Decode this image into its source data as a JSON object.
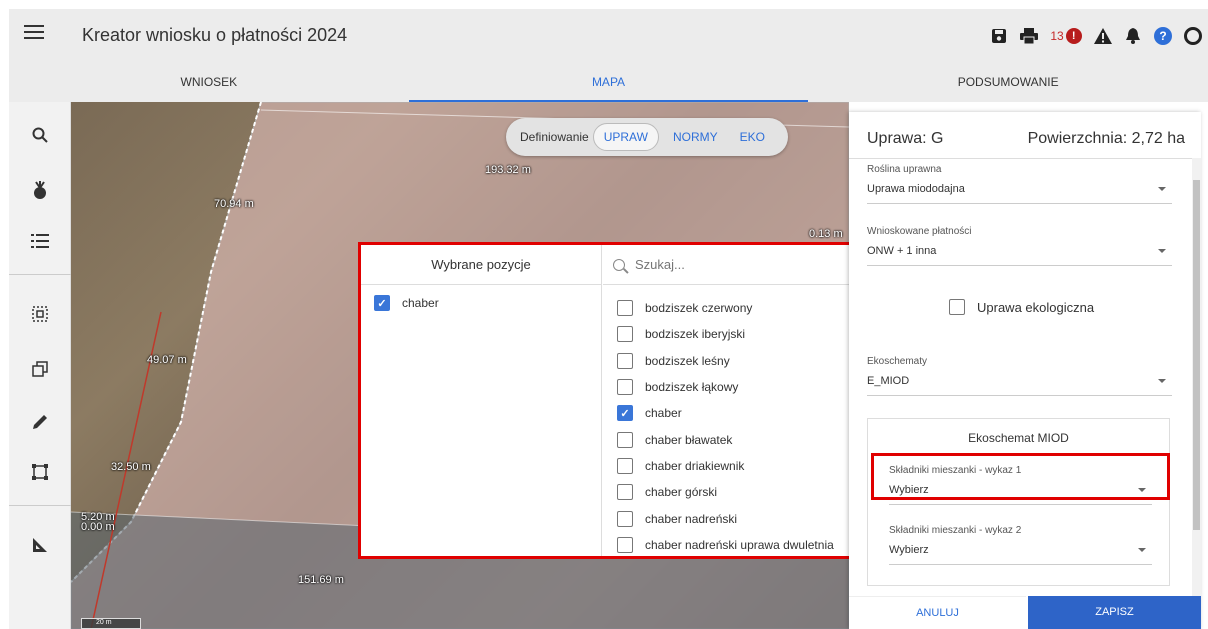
{
  "header": {
    "title": "Kreator wniosku o płatności 2024",
    "notification_count": "13",
    "error_icon_glyph": "!",
    "help_icon_glyph": "?"
  },
  "tabs": [
    {
      "label": "WNIOSEK"
    },
    {
      "label": "MAPA"
    },
    {
      "label": "PODSUMOWANIE"
    }
  ],
  "map": {
    "toggle_label": "Definiowanie",
    "toggle_options": [
      "UPRAW",
      "NORMY",
      "EKO"
    ],
    "measurements": [
      "193.32 m",
      "70.94 m",
      "0.13 m",
      "49.07 m",
      "32.50 m",
      "5.20 m",
      "0.00 m",
      "151.69 m"
    ],
    "scale_label": "20 m"
  },
  "dialog": {
    "selected_header": "Wybrane pozycje",
    "selected_items": [
      "chaber"
    ],
    "search_placeholder": "Szukaj...",
    "options": [
      {
        "label": "bodziszek czerwony",
        "checked": false
      },
      {
        "label": "bodziszek iberyjski",
        "checked": false
      },
      {
        "label": "bodziszek leśny",
        "checked": false
      },
      {
        "label": "bodziszek łąkowy",
        "checked": false
      },
      {
        "label": "chaber",
        "checked": true
      },
      {
        "label": "chaber bławatek",
        "checked": false
      },
      {
        "label": "chaber driakiewnik",
        "checked": false
      },
      {
        "label": "chaber górski",
        "checked": false
      },
      {
        "label": "chaber nadreński",
        "checked": false
      },
      {
        "label": "chaber nadreński uprawa dwuletnia",
        "checked": false
      }
    ]
  },
  "panel": {
    "title": "Uprawa: G",
    "area": "Powierzchnia: 2,72 ha",
    "crop_label": "Roślina uprawna",
    "crop_value": "Uprawa miododajna",
    "payments_label": "Wnioskowane płatności",
    "payments_value": "ONW + 1 inna",
    "eco_label": "Uprawa ekologiczna",
    "ecoschemes_label": "Ekoschematy",
    "ecoschemes_value": "E_MIOD",
    "miod_title": "Ekoschemat MIOD",
    "mix1_label": "Składniki mieszanki - wykaz 1",
    "mix1_value": "Wybierz",
    "mix2_label": "Składniki mieszanki - wykaz 2",
    "mix2_value": "Wybierz",
    "cancel": "ANULUJ",
    "save": "ZAPISZ"
  },
  "colors": {
    "accent": "#2e6fd8",
    "highlight": "#e00000",
    "save_button": "#2e64c8"
  }
}
